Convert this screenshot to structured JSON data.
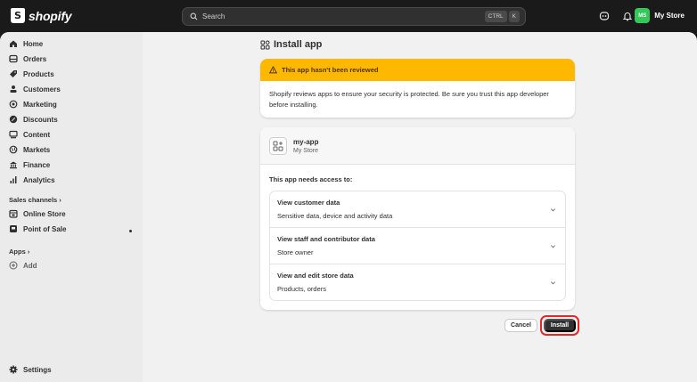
{
  "topbar": {
    "logo_text": "shopify",
    "search_placeholder": "Search",
    "shortcut_keys": [
      "CTRL",
      "K"
    ],
    "store_initials": "MS",
    "store_name": "My Store"
  },
  "sidebar": {
    "items": [
      {
        "label": "Home",
        "icon": "home-icon"
      },
      {
        "label": "Orders",
        "icon": "orders-icon"
      },
      {
        "label": "Products",
        "icon": "tag-icon"
      },
      {
        "label": "Customers",
        "icon": "person-icon"
      },
      {
        "label": "Marketing",
        "icon": "target-icon"
      },
      {
        "label": "Discounts",
        "icon": "discount-icon"
      },
      {
        "label": "Content",
        "icon": "content-icon"
      },
      {
        "label": "Markets",
        "icon": "globe-icon"
      },
      {
        "label": "Finance",
        "icon": "bank-icon"
      },
      {
        "label": "Analytics",
        "icon": "bar-chart-icon"
      }
    ],
    "sales_channels_label": "Sales channels",
    "channels": [
      {
        "label": "Online Store",
        "icon": "store-icon"
      },
      {
        "label": "Point of Sale",
        "icon": "pos-icon"
      }
    ],
    "apps_label": "Apps",
    "add_label": "Add",
    "settings_label": "Settings"
  },
  "page": {
    "title": "Install app",
    "banner_title": "This app hasn't been reviewed",
    "banner_body": "Shopify reviews apps to ensure your security is protected. Be sure you trust this app developer before installing.",
    "app_name": "my-app",
    "app_store": "My Store",
    "access_label": "This app needs access to:",
    "permissions": [
      {
        "title": "View customer data",
        "desc": "Sensitive data, device and activity data"
      },
      {
        "title": "View staff and contributor data",
        "desc": "Store owner"
      },
      {
        "title": "View and edit store data",
        "desc": "Products, orders"
      }
    ],
    "cancel_label": "Cancel",
    "install_label": "Install"
  },
  "colors": {
    "banner": "#ffb800",
    "avatar": "#34c759",
    "highlight": "#e02a2a",
    "primary_button": "#303030"
  }
}
